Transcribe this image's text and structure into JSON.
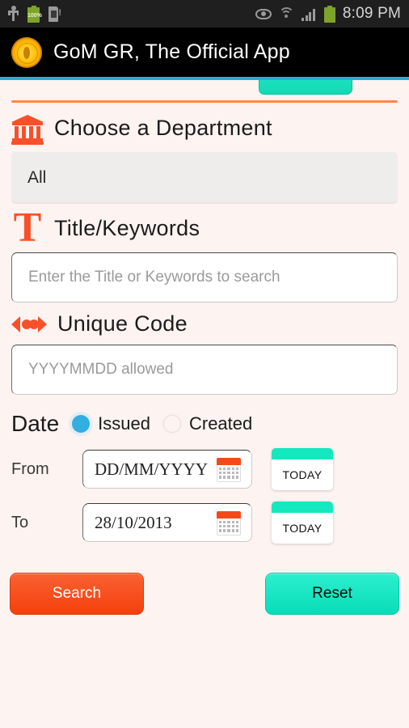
{
  "statusbar": {
    "time": "8:09 PM",
    "battery_percent": "100%",
    "icons": [
      "usb-icon",
      "battery-icon",
      "sim-card-alert-icon",
      "eye-icon",
      "wifi-icon",
      "signal-icon",
      "battery-icon"
    ]
  },
  "titlebar": {
    "app_title": "GoM GR, The Official App",
    "logo": "government-seal-icon"
  },
  "theme": {
    "background": "#FDF3F0",
    "accent_orange": "#F8502A",
    "accent_teal": "#14E8BE",
    "accent_blue": "#29ABE2",
    "divider_orange": "#FB8B4B",
    "titlebar_black": "#000000"
  },
  "department": {
    "icon": "bank-icon",
    "heading": "Choose a Department",
    "selected_value": "All"
  },
  "title_keywords": {
    "icon": "letter-t-icon",
    "heading": "Title/Keywords",
    "value": "",
    "placeholder": "Enter the Title or Keywords to search"
  },
  "unique_code": {
    "icon": "code-brackets-icon",
    "heading": "Unique Code",
    "value": "",
    "placeholder": "YYYYMMDD allowed"
  },
  "date": {
    "label": "Date",
    "options": [
      {
        "label": "Issued",
        "selected": true
      },
      {
        "label": "Created",
        "selected": false
      }
    ],
    "from": {
      "label": "From",
      "value": "DD/MM/YYYY",
      "calendar_icon": "calendar-icon",
      "today_label": "TODAY"
    },
    "to": {
      "label": "To",
      "value": "28/10/2013",
      "calendar_icon": "calendar-icon",
      "today_label": "TODAY"
    }
  },
  "actions": {
    "search_label": "Search",
    "reset_label": "Reset"
  }
}
